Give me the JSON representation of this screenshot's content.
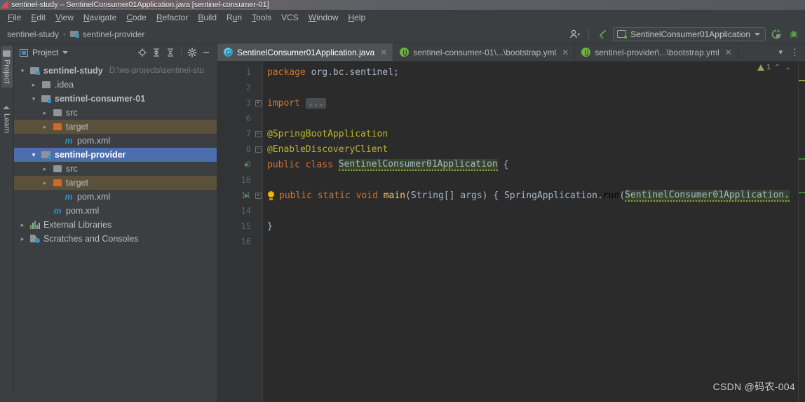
{
  "window": {
    "title": "sentinel-study – SentinelConsumer01Application.java [sentinel-consumer-01]"
  },
  "menubar": {
    "items": [
      {
        "mnemonic": "F",
        "rest": "ile"
      },
      {
        "mnemonic": "E",
        "rest": "dit"
      },
      {
        "mnemonic": "V",
        "rest": "iew"
      },
      {
        "mnemonic": "N",
        "rest": "avigate"
      },
      {
        "mnemonic": "C",
        "rest": "ode"
      },
      {
        "mnemonic": "R",
        "rest": "efactor"
      },
      {
        "mnemonic": "B",
        "rest": "uild"
      },
      {
        "mnemonic": "R",
        "rest": "un",
        "pre": "R",
        "mid": "u",
        "post": "n"
      },
      {
        "mnemonic": "T",
        "rest": "ools"
      },
      {
        "mnemonic": "",
        "rest": "VCS"
      },
      {
        "mnemonic": "W",
        "rest": "indow"
      },
      {
        "mnemonic": "H",
        "rest": "elp"
      }
    ],
    "labels": [
      "File",
      "Edit",
      "View",
      "Navigate",
      "Code",
      "Refactor",
      "Build",
      "Run",
      "Tools",
      "VCS",
      "Window",
      "Help"
    ]
  },
  "navbar": {
    "breadcrumb_root": "sentinel-study",
    "breadcrumb_sep": "›",
    "breadcrumb_current": "sentinel-provider",
    "run_config": "SentinelConsumer01Application",
    "icons": [
      "user-profile-icon",
      "dropdown-caret-icon",
      "back-arrow-icon",
      "run-icon",
      "debug-icon"
    ]
  },
  "toolstrip": {
    "tabs": [
      {
        "label": "Project",
        "icon": "folder-icon",
        "active": true
      },
      {
        "label": "Learn",
        "icon": "graduation-cap-icon",
        "active": false
      }
    ]
  },
  "project_panel": {
    "title": "Project",
    "tool_icons": [
      "locate-icon",
      "expand-all-icon",
      "collapse-all-icon",
      "settings-gear-icon",
      "hide-panel-icon"
    ],
    "tree": [
      {
        "label": "sentinel-study",
        "path": "D:\\ws-projects\\sentinel-stu",
        "indent": 0,
        "arrow": "⌄",
        "icon": "module",
        "bold": true,
        "state": "normal"
      },
      {
        "label": ".idea",
        "indent": 1,
        "arrow": "›",
        "icon": "folder",
        "bold": false,
        "state": "normal"
      },
      {
        "label": "sentinel-consumer-01",
        "indent": 1,
        "arrow": "⌄",
        "icon": "module",
        "bold": true,
        "state": "normal"
      },
      {
        "label": "src",
        "indent": 2,
        "arrow": "›",
        "icon": "folder",
        "bold": false,
        "state": "normal"
      },
      {
        "label": "target",
        "indent": 2,
        "arrow": "›",
        "icon": "folder-orange",
        "bold": false,
        "state": "excluded"
      },
      {
        "label": "pom.xml",
        "indent": 3,
        "arrow": "",
        "icon": "maven",
        "bold": false,
        "state": "normal"
      },
      {
        "label": "sentinel-provider",
        "indent": 1,
        "arrow": "⌄",
        "icon": "module",
        "bold": true,
        "state": "selected"
      },
      {
        "label": "src",
        "indent": 2,
        "arrow": "›",
        "icon": "folder",
        "bold": false,
        "state": "normal"
      },
      {
        "label": "target",
        "indent": 2,
        "arrow": "›",
        "icon": "folder-orange",
        "bold": false,
        "state": "excluded"
      },
      {
        "label": "pom.xml",
        "indent": 3,
        "arrow": "",
        "icon": "maven",
        "bold": false,
        "state": "normal"
      },
      {
        "label": "pom.xml",
        "indent": 2,
        "arrow": "",
        "icon": "maven",
        "bold": false,
        "state": "normal"
      },
      {
        "label": "External Libraries",
        "indent": 0,
        "arrow": "›",
        "icon": "library",
        "bold": false,
        "state": "normal"
      },
      {
        "label": "Scratches and Consoles",
        "indent": 0,
        "arrow": "›",
        "icon": "scratch",
        "bold": false,
        "state": "normal"
      }
    ]
  },
  "editor": {
    "tabs": [
      {
        "label": "SentinelConsumer01Application.java",
        "icon": "java-class-icon",
        "active": true,
        "closable": true
      },
      {
        "label": "sentinel-consumer-01\\...\\bootstrap.yml",
        "icon": "spring-icon",
        "active": false,
        "closable": true
      },
      {
        "label": "sentinel-provider\\...\\bootstrap.yml",
        "icon": "spring-icon",
        "active": false,
        "closable": true
      }
    ],
    "tab_overflow_icon": "chevron-down-icon",
    "tab_menu_icon": "kebab-menu-icon",
    "inspection": {
      "warning_count": "1",
      "up_icon": "chevron-up-icon",
      "down_icon": "chevron-down-icon"
    },
    "line_numbers": [
      "1",
      "2",
      "3",
      "6",
      "7",
      "8",
      "9",
      "10",
      "11",
      "14",
      "15",
      "16"
    ],
    "lines": [
      {
        "num": "1",
        "tokens": [
          {
            "t": "package ",
            "c": "kw"
          },
          {
            "t": "org.bc.sentinel;",
            "c": "pl"
          }
        ]
      },
      {
        "num": "2",
        "tokens": []
      },
      {
        "num": "3",
        "fold": "plus",
        "tokens": [
          {
            "t": "import ",
            "c": "kw"
          },
          {
            "t": "...",
            "c": "dots"
          }
        ]
      },
      {
        "num": "6",
        "tokens": []
      },
      {
        "num": "7",
        "fold": "brace-top",
        "tokens": [
          {
            "t": "@SpringBootApplication",
            "c": "ann"
          }
        ]
      },
      {
        "num": "8",
        "fold": "brace-mid",
        "tokens": [
          {
            "t": "@EnableDiscoveryClient",
            "c": "ann"
          }
        ]
      },
      {
        "num": "9",
        "run": true,
        "tokens": [
          {
            "t": "public ",
            "c": "kw"
          },
          {
            "t": "class ",
            "c": "kw"
          },
          {
            "t": "SentinelConsumer01Application",
            "c": "cls-err"
          },
          {
            "t": " {",
            "c": "pl"
          }
        ]
      },
      {
        "num": "10",
        "tokens": []
      },
      {
        "num": "11",
        "run": true,
        "fold": "plus",
        "bulb": true,
        "tokens": [
          {
            "t": "public ",
            "c": "kw"
          },
          {
            "t": "static ",
            "c": "kw"
          },
          {
            "t": "void ",
            "c": "kw"
          },
          {
            "t": "main",
            "c": "mtd"
          },
          {
            "t": "(String[] args) { ",
            "c": "pl"
          },
          {
            "t": "SpringApplication.",
            "c": "pl"
          },
          {
            "t": "run",
            "c": "ital"
          },
          {
            "t": "(",
            "c": "pl"
          },
          {
            "t": "SentinelConsumer01Application.",
            "c": "cls-err"
          }
        ]
      },
      {
        "num": "14",
        "tokens": []
      },
      {
        "num": "15",
        "tokens": [
          {
            "t": "}",
            "c": "pl"
          }
        ]
      },
      {
        "num": "16",
        "tokens": []
      }
    ]
  },
  "watermark": "CSDN @码农-004",
  "colors": {
    "panel_bg": "#3c3f41",
    "editor_bg": "#2b2b2b",
    "gutter_bg": "#313335",
    "selection_blue": "#4b6eaf",
    "excluded_brown": "#5b513b",
    "keyword_orange": "#cc7832",
    "annotation_yellow": "#bbb529",
    "plain_text": "#a9b7c6",
    "method_yellow": "#ffc66d",
    "run_green": "#499c54",
    "spring_green": "#6db33f",
    "maven_blue": "#2b9ac9",
    "folder_orange": "#cf6a2e"
  }
}
